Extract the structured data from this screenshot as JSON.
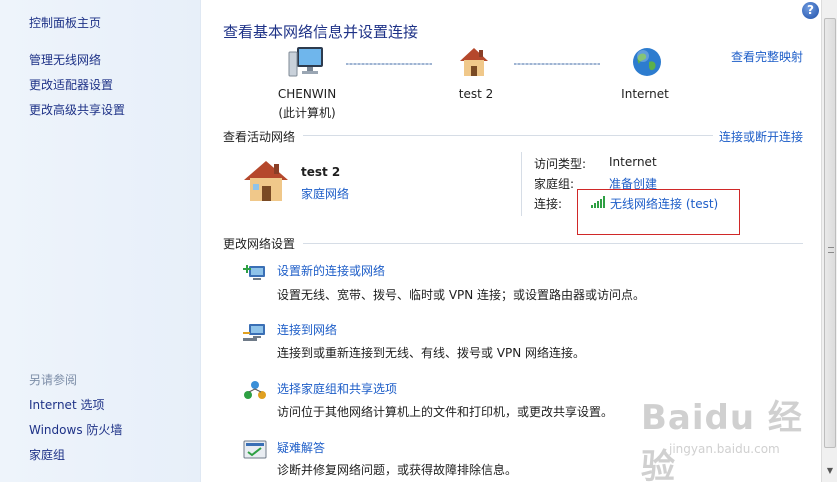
{
  "sidebar": {
    "home": "控制面板主页",
    "links": [
      "管理无线网络",
      "更改适配器设置",
      "更改高级共享设置"
    ],
    "see_also_title": "另请参阅",
    "see_also": [
      "Internet 选项",
      "Windows 防火墙",
      "家庭组"
    ]
  },
  "header": {
    "title": "查看基本网络信息并设置连接",
    "full_map_link": "查看完整映射"
  },
  "network_map": {
    "computer_name": "CHENWIN",
    "computer_sub": "(此计算机)",
    "network_name": "test  2",
    "internet_label": "Internet"
  },
  "active_networks": {
    "title": "查看活动网络",
    "connect_link": "连接或断开连接",
    "name": "test  2",
    "type": "家庭网络",
    "access_type_label": "访问类型:",
    "access_type_value": "Internet",
    "homegroup_label": "家庭组:",
    "homegroup_value": "准备创建",
    "connection_label": "连接:",
    "connection_value": "无线网络连接 (test)"
  },
  "change_settings": {
    "title": "更改网络设置",
    "tasks": [
      {
        "label": "设置新的连接或网络",
        "desc": "设置无线、宽带、拨号、临时或 VPN 连接；或设置路由器或访问点。"
      },
      {
        "label": "连接到网络",
        "desc": "连接到或重新连接到无线、有线、拨号或 VPN 网络连接。"
      },
      {
        "label": "选择家庭组和共享选项",
        "desc": "访问位于其他网络计算机上的文件和打印机，或更改共享设置。"
      },
      {
        "label": "疑难解答",
        "desc": "诊断并修复网络问题，或获得故障排除信息。"
      }
    ]
  },
  "help_label": "?",
  "watermark": {
    "logo": "Baidu 经验",
    "url": "jingyan.baidu.com"
  },
  "colors": {
    "link": "#1e5ec8",
    "title": "#1e3287",
    "highlight": "#d02828"
  }
}
